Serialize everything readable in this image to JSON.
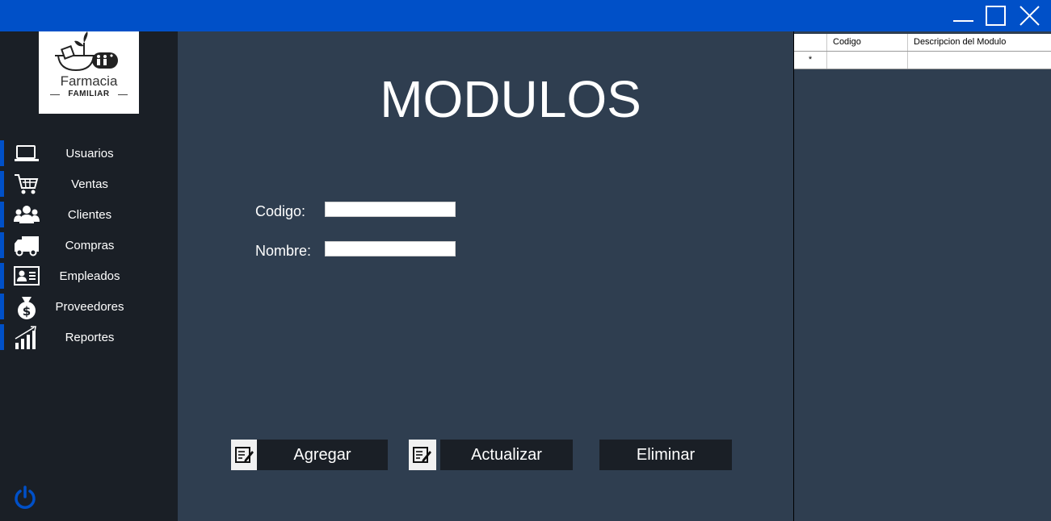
{
  "window": {
    "titlebar_color": "#0050c8",
    "controls": [
      "minimize-icon",
      "maximize-icon",
      "close-icon"
    ]
  },
  "logo": {
    "name": "Farmacia",
    "subtitle": "FAMILIAR"
  },
  "sidebar": {
    "accent_color": "#0050c8",
    "items": [
      {
        "label": "Usuarios",
        "icon": "laptop-icon"
      },
      {
        "label": "Ventas",
        "icon": "cart-icon"
      },
      {
        "label": "Clientes",
        "icon": "users-icon"
      },
      {
        "label": "Compras",
        "icon": "truck-icon"
      },
      {
        "label": "Empleados",
        "icon": "id-card-icon"
      },
      {
        "label": "Proveedores",
        "icon": "money-bag-icon"
      },
      {
        "label": "Reportes",
        "icon": "bar-chart-icon"
      }
    ],
    "power_icon": "power-icon"
  },
  "main": {
    "title": "MODULOS",
    "fields": {
      "codigo": {
        "label": "Codigo:",
        "value": ""
      },
      "nombre": {
        "label": "Nombre:",
        "value": ""
      }
    },
    "buttons": {
      "agregar": "Agregar",
      "actualizar": "Actualizar",
      "eliminar": "Eliminar"
    }
  },
  "grid": {
    "columns": [
      "",
      "Codigo",
      "Descripcion del Modulo"
    ],
    "new_row_marker": "*"
  }
}
